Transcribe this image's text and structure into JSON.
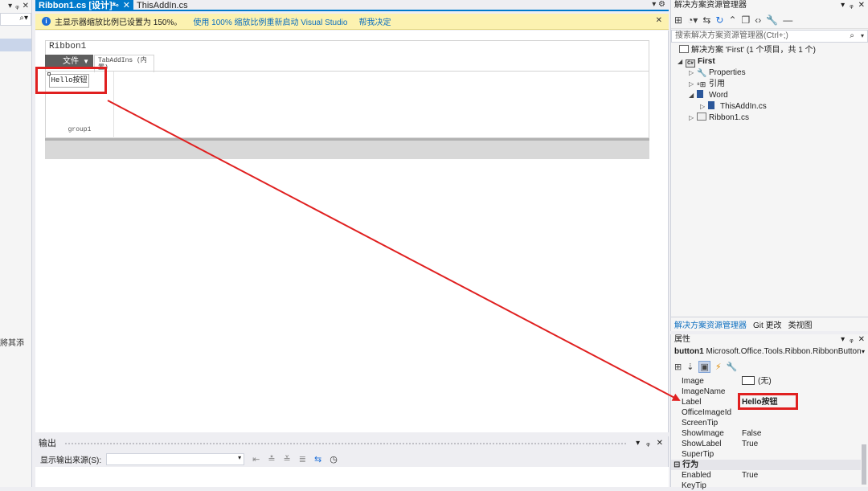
{
  "left_strip": {
    "header_controls": [
      "▾",
      "ᵩ",
      "✕"
    ],
    "search_icon": "⌕▾",
    "truncated_text": "將其添"
  },
  "tabs": [
    {
      "label": "Ribbon1.cs [设计]*",
      "pin": "⊸",
      "close": "✕",
      "active": true
    },
    {
      "label": "ThisAddIn.cs",
      "active": false
    }
  ],
  "tab_overflow": "▾ ⚙",
  "infobar": {
    "icon": "i",
    "message": "主显示器缩放比例已设置为 150%。",
    "link1": "使用 100% 缩放比例重新启动 Visual Studio",
    "link2": "帮我决定",
    "close": "✕"
  },
  "designer": {
    "ribbon_name": "Ribbon1",
    "file_tab": "文件",
    "file_tab_arrow": "▼",
    "addins_tab": "TabAddIns (内置)",
    "button_label": "Hello按钮",
    "group_label": "group1"
  },
  "output": {
    "title": "输出",
    "controls": [
      "▾",
      "ᵩ",
      "✕"
    ],
    "source_label": "显示输出来源(S):",
    "select_value": "",
    "select_arrow": "▾"
  },
  "solution_explorer": {
    "title": "解决方案资源管理器",
    "controls": [
      "▾",
      "ᵩ",
      "✕"
    ],
    "search_placeholder": "搜索解决方案资源管理器(Ctrl+;)",
    "search_icon": "⌕",
    "search_dd": "▾",
    "solution_line": "解决方案 'First' (1 个项目，共 1 个)",
    "tree": {
      "project": "First",
      "properties": "Properties",
      "references": "引用",
      "word": "Word",
      "thisaddin": "ThisAddIn.cs",
      "ribbon1": "Ribbon1.cs"
    },
    "bottom_tabs": [
      "解决方案资源管理器",
      "Git 更改",
      "类视图"
    ]
  },
  "properties": {
    "title": "属性",
    "controls": [
      "▾",
      "ᵩ",
      "✕"
    ],
    "object": "button1",
    "object_type": "Microsoft.Office.Tools.Ribbon.RibbonButton",
    "rows": [
      {
        "key": "Image",
        "value": "(无)"
      },
      {
        "key": "ImageName",
        "value": ""
      },
      {
        "key": "Label",
        "value": "Hello按钮"
      },
      {
        "key": "OfficeImageId",
        "value": ""
      },
      {
        "key": "ScreenTip",
        "value": ""
      },
      {
        "key": "ShowImage",
        "value": "False"
      },
      {
        "key": "ShowLabel",
        "value": "True"
      },
      {
        "key": "SuperTip",
        "value": ""
      }
    ],
    "category": "行为",
    "category_toggle": "⊟",
    "rows2": [
      {
        "key": "Enabled",
        "value": "True"
      },
      {
        "key": "KeyTip",
        "value": ""
      }
    ]
  },
  "colors": {
    "accent": "#007acc",
    "annotation_red": "#e02020",
    "infobar_bg": "#fcf2b0"
  }
}
